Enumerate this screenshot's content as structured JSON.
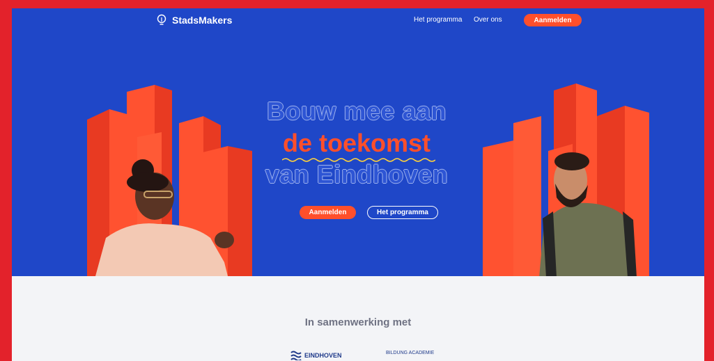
{
  "nav": {
    "logo_text": "StadsMakers",
    "links": [
      "Het programma",
      "Over ons"
    ],
    "cta_label": "Aanmelden"
  },
  "hero": {
    "headline_line1": "Bouw mee aan",
    "headline_line2": "de toekomst",
    "headline_line3": "van Eindhoven",
    "primary_button": "Aanmelden",
    "secondary_button": "Het programma"
  },
  "partners": {
    "title": "In samenwerking met",
    "logos": [
      "EINDHOVEN",
      "BILDUNG ACADEMIE"
    ]
  },
  "colors": {
    "hero_blue": "#1f47c8",
    "accent_orange": "#ff4f2b",
    "frame_red": "#e3222b"
  }
}
